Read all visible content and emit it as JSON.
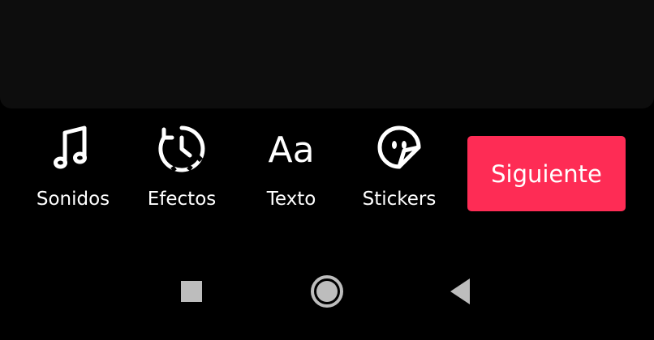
{
  "toolbar": {
    "items": [
      {
        "label": "Sonidos",
        "icon": "music-note-icon"
      },
      {
        "label": "Efectos",
        "icon": "effects-timer-icon"
      },
      {
        "label": "Texto",
        "icon": "text-aa-icon"
      },
      {
        "label": "Stickers",
        "icon": "sticker-face-icon"
      }
    ],
    "next_label": "Siguiente"
  },
  "navbar": {
    "icons": [
      "recents-square-icon",
      "home-circle-icon",
      "back-triangle-icon"
    ]
  },
  "colors": {
    "accent": "#fe2c55",
    "background": "#000000",
    "preview": "#0d0d0d",
    "nav_icon": "#bdbdbd"
  }
}
